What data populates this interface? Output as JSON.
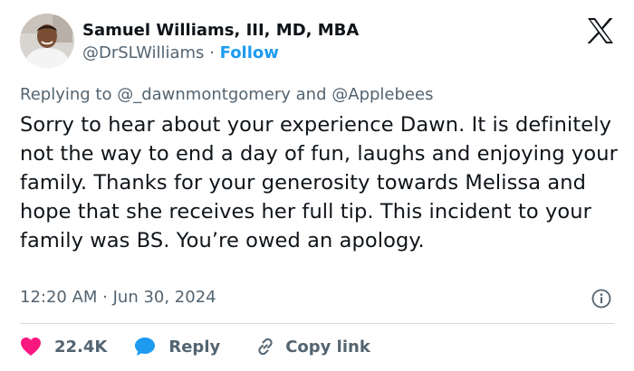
{
  "author": {
    "display_name": "Samuel Williams, III, MD, MBA",
    "handle": "@DrSLWilliams",
    "separator": "·",
    "follow_label": "Follow"
  },
  "brand": {
    "logo_icon": "x-logo-icon"
  },
  "reply_context": {
    "prefix": "Replying to",
    "user1": "@_dawnmontgomery",
    "conjunction": "and",
    "user2": "@Applebees"
  },
  "tweet": {
    "text": "Sorry to hear about your experience Dawn. It is definitely not the way to end a day of fun, laughs and enjoying your family. Thanks for your generosity towards Melissa and hope that she receives her full tip. This incident to your family was BS. You’re owed an apology.",
    "timestamp": "12:20 AM · Jun 30, 2024"
  },
  "actions": {
    "likes_count": "22.4K",
    "reply_label": "Reply",
    "copy_link_label": "Copy link"
  },
  "icons": {
    "like": "heart-icon",
    "reply": "speech-bubble-icon",
    "copy": "link-icon",
    "info": "info-icon"
  },
  "colors": {
    "heart": "#f91880",
    "reply_bubble": "#1d9bf0",
    "link_text": "#536471",
    "follow": "#1d9bf0",
    "text": "#0f1419",
    "muted": "#536471",
    "divider": "#cfd9de"
  }
}
